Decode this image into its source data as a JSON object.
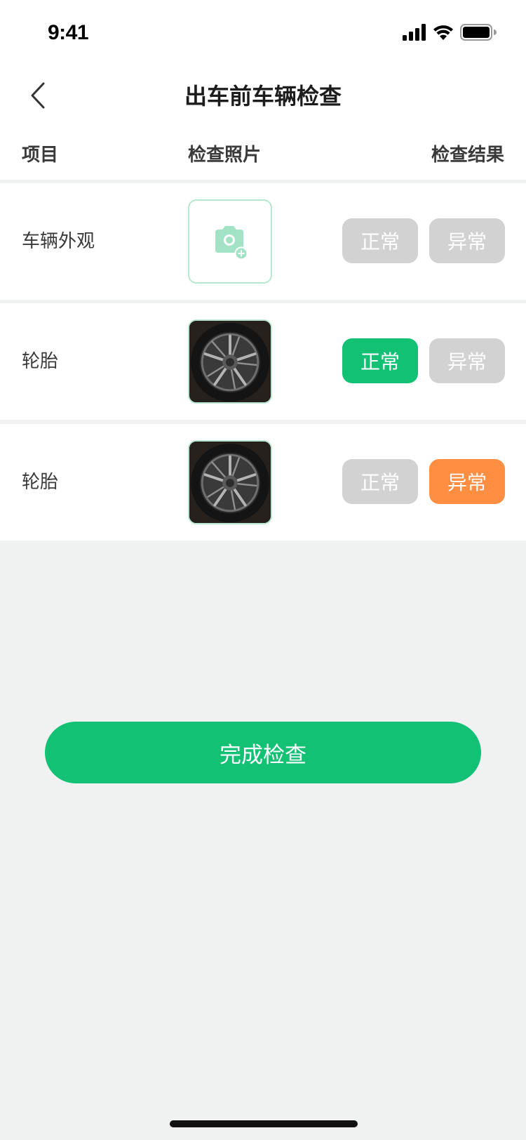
{
  "status_bar": {
    "time": "9:41",
    "icons": [
      "cellular-signal-icon",
      "wifi-icon",
      "battery-icon"
    ]
  },
  "nav": {
    "back_icon": "chevron-left-icon",
    "title": "出车前车辆检查"
  },
  "table": {
    "headers": {
      "item": "项目",
      "photo": "检查照片",
      "result": "检查结果"
    },
    "rows": [
      {
        "label": "车辆外观",
        "photo": "camera-add-icon",
        "normal_label": "正常",
        "abnormal_label": "异常",
        "result": "none"
      },
      {
        "label": "轮胎",
        "photo": "tire-photo",
        "normal_label": "正常",
        "abnormal_label": "异常",
        "result": "normal"
      },
      {
        "label": "轮胎",
        "photo": "tire-photo",
        "normal_label": "正常",
        "abnormal_label": "异常",
        "result": "abnormal"
      }
    ]
  },
  "actions": {
    "complete_label": "完成检查"
  },
  "colors": {
    "accent_green": "#13c174",
    "warning_orange": "#ff8e42",
    "inactive_gray": "#d2d2d2",
    "photo_border": "#b8e6d0",
    "page_background": "#f0f1f1"
  }
}
